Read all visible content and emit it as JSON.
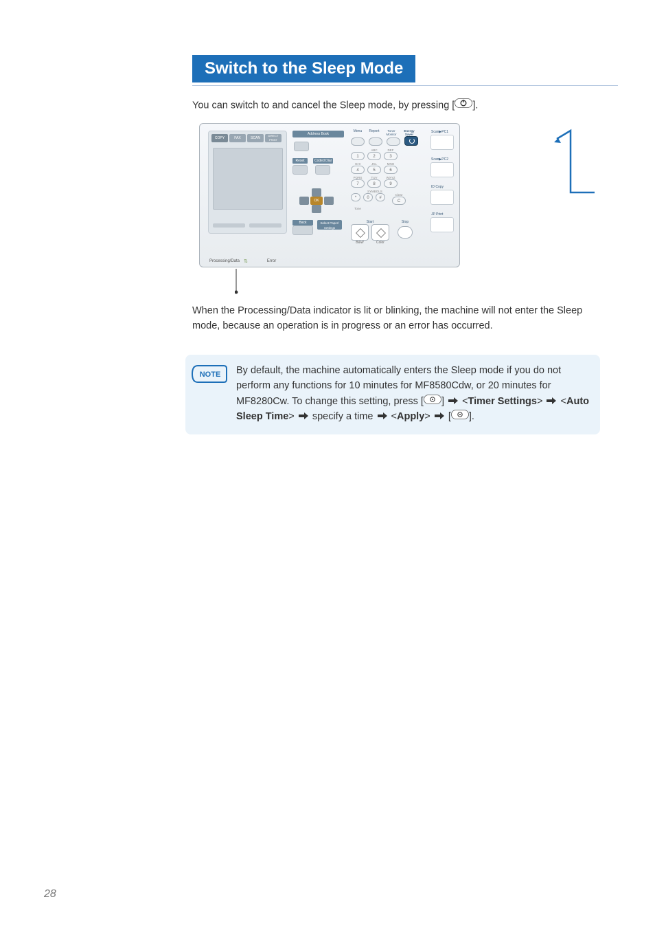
{
  "page_number": "28",
  "heading": "Switch to the Sleep Mode",
  "intro_pre": "You can switch to and cancel the Sleep mode, by pressing [",
  "intro_post": "].",
  "panel": {
    "tabs": [
      "COPY",
      "FAX",
      "SCAN",
      "DIRECT PRINT"
    ],
    "address_book": "Address Book",
    "reset": "Reset",
    "coded_dial": "Coded Dial",
    "ok": "OK",
    "back": "Back",
    "select": "Select Paper/ Settings",
    "top_labels": [
      "Menu",
      "Report",
      "Toner Monitor",
      "Energy Saver"
    ],
    "numpad_letters": [
      "",
      "ABC",
      "DEF",
      "GHI",
      "JKL",
      "MNO",
      "PQRS",
      "TUV",
      "WXYZ",
      "",
      "SYMBOLS",
      ""
    ],
    "numpad_keys": [
      "1",
      "2",
      "3",
      "4",
      "5",
      "6",
      "7",
      "8",
      "9",
      "*",
      "0",
      "#"
    ],
    "tone": "Tone",
    "clear_sym": "C",
    "clear": "Clear",
    "start": "Start",
    "bw": "B&W",
    "color": "Color",
    "stop": "Stop",
    "side": [
      "Scan▶PC1",
      "Scan▶PC2",
      "ID Copy",
      "JP Print"
    ],
    "processing": "Processing/Data",
    "error": "Error"
  },
  "caption": "When the Processing/Data indicator is lit or blinking, the machine will not enter the Sleep mode, because an operation is in progress or an error has occurred.",
  "note": {
    "badge": "NOTE",
    "line1": "By default, the machine automatically enters the Sleep mode if you do not perform any functions for 10 minutes for MF8580Cdw, or 20 minutes for MF8280Cw. To change this setting, press [",
    "timer_settings": "Timer Settings",
    "auto_sleep": "Auto Sleep Time",
    "specify": " specify a time ",
    "apply": "Apply"
  }
}
